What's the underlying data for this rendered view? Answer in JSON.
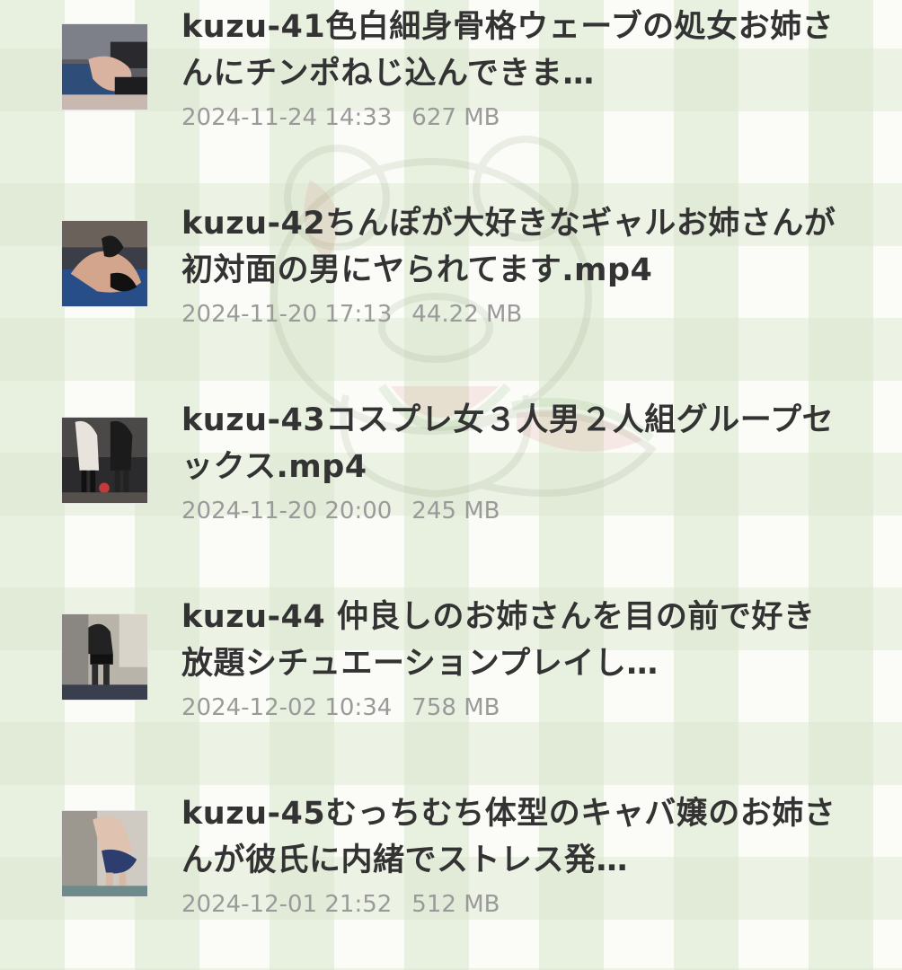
{
  "files": [
    {
      "title": "kuzu-41色白細身骨格ウェーブの処女お姉さんにチンポねじ込んできま…",
      "date": "2024-11-24 14:33",
      "size": "627 MB",
      "thumbnail": "photo-thumbnail"
    },
    {
      "title": "kuzu-42ちんぽが大好きなギャルお姉さんが初対面の男にヤられてます.mp4",
      "date": "2024-11-20 17:13",
      "size": "44.22 MB",
      "thumbnail": "photo-thumbnail"
    },
    {
      "title": "kuzu-43コスプレ女３人男２人組グループセックス.mp4",
      "date": "2024-11-20 20:00",
      "size": "245 MB",
      "thumbnail": "photo-thumbnail"
    },
    {
      "title": "kuzu-44 仲良しのお姉さんを目の前で好き放題シチュエーションプレイし…",
      "date": "2024-12-02 10:34",
      "size": "758 MB",
      "thumbnail": "photo-thumbnail"
    },
    {
      "title": "kuzu-45むっちむち体型のキャバ嬢のお姉さんが彼氏に内緒でストレス発…",
      "date": "2024-12-01 21:52",
      "size": "512 MB",
      "thumbnail": "photo-thumbnail"
    }
  ],
  "colors": {
    "title_text": "#333333",
    "meta_text": "#9a9a9a",
    "background": "#fbfcf7",
    "wallpaper_check": "#dae6cd"
  }
}
